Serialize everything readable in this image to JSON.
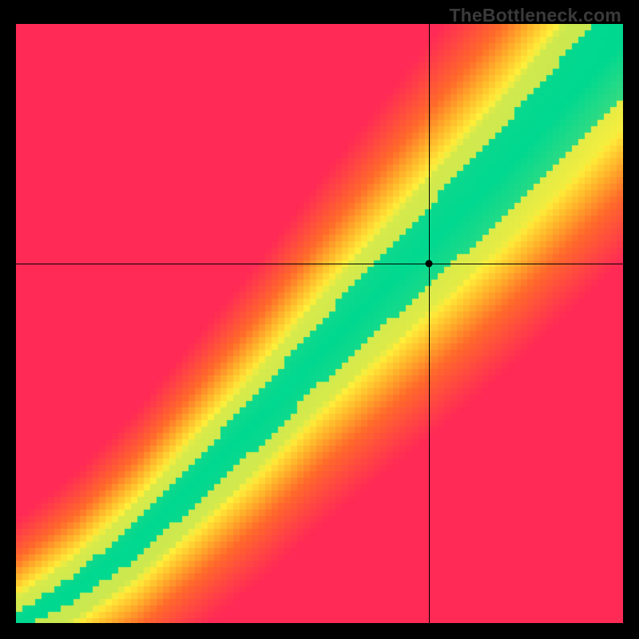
{
  "watermark": "TheBottleneck.com",
  "chart_data": {
    "type": "heatmap",
    "title": "",
    "xlabel": "",
    "ylabel": "",
    "xlim": [
      0,
      100
    ],
    "ylim": [
      0,
      100
    ],
    "crosshair": {
      "x": 68,
      "y": 60
    },
    "marker": {
      "x": 68,
      "y": 60
    },
    "ridge": {
      "description": "Green optimal band along a slightly super-linear diagonal; corners red; transitional orange/yellow.",
      "control_points": [
        {
          "x": 0,
          "y_center": 0,
          "half_width": 1.5
        },
        {
          "x": 10,
          "y_center": 6,
          "half_width": 2.2
        },
        {
          "x": 20,
          "y_center": 14,
          "half_width": 3.0
        },
        {
          "x": 30,
          "y_center": 24,
          "half_width": 3.8
        },
        {
          "x": 40,
          "y_center": 34,
          "half_width": 4.5
        },
        {
          "x": 50,
          "y_center": 45,
          "half_width": 5.2
        },
        {
          "x": 60,
          "y_center": 55,
          "half_width": 6.0
        },
        {
          "x": 70,
          "y_center": 65,
          "half_width": 6.8
        },
        {
          "x": 80,
          "y_center": 75,
          "half_width": 7.5
        },
        {
          "x": 90,
          "y_center": 86,
          "half_width": 8.3
        },
        {
          "x": 100,
          "y_center": 97,
          "half_width": 9.0
        }
      ]
    },
    "color_stops": [
      {
        "t": 0.0,
        "color": "#ff2a55"
      },
      {
        "t": 0.35,
        "color": "#ff6a2a"
      },
      {
        "t": 0.55,
        "color": "#ffb02a"
      },
      {
        "t": 0.75,
        "color": "#ffef3a"
      },
      {
        "t": 0.9,
        "color": "#8be06a"
      },
      {
        "t": 1.0,
        "color": "#00d890"
      }
    ],
    "pixelation": 8
  }
}
